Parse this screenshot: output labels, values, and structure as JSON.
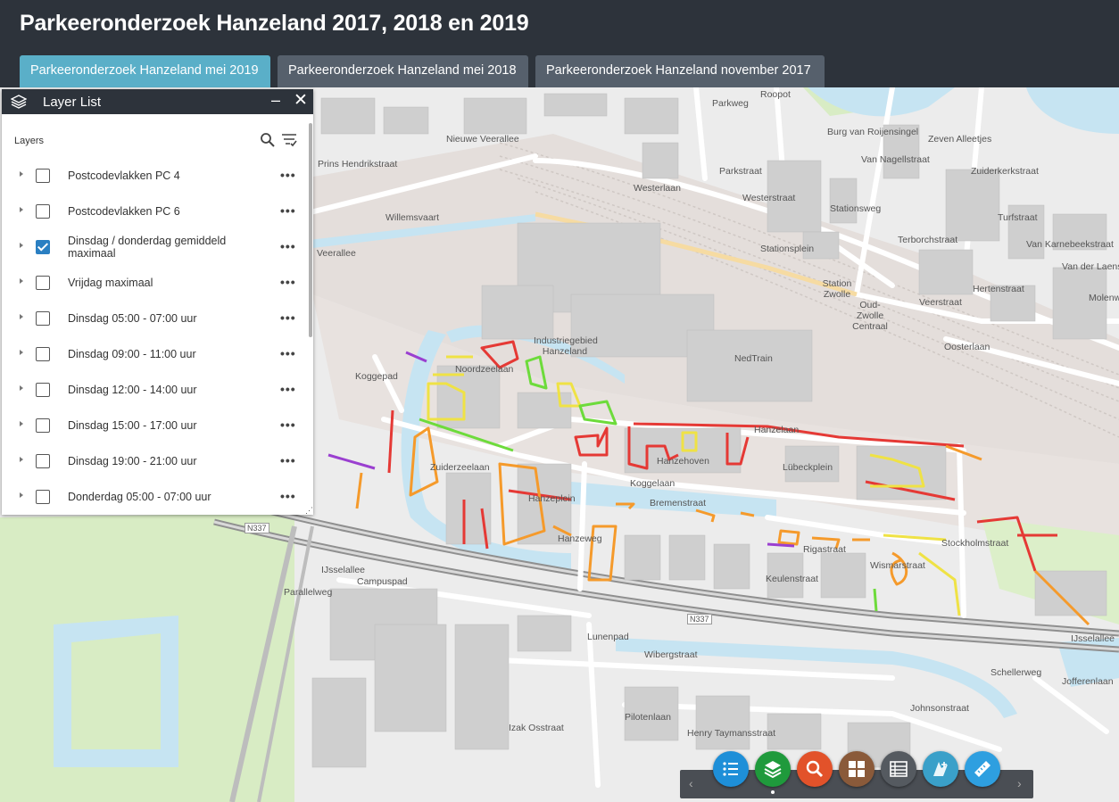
{
  "app": {
    "title": "Parkeeronderzoek Hanzeland 2017, 2018 en 2019"
  },
  "tabs": [
    {
      "label": "Parkeeronderzoek Hanzeland mei 2019",
      "active": true
    },
    {
      "label": "Parkeeronderzoek Hanzeland mei 2018",
      "active": false
    },
    {
      "label": "Parkeeronderzoek Hanzeland november 2017",
      "active": false
    }
  ],
  "panel": {
    "title": "Layer List",
    "icon": "layers-icon",
    "minimize_symbol": "–",
    "close_symbol": "✕",
    "layers_label": "Layers",
    "more_symbol": "•••",
    "layers": [
      {
        "label": "Postcodevlakken PC 4",
        "checked": false
      },
      {
        "label": "Postcodevlakken PC 6",
        "checked": false
      },
      {
        "label": "Dinsdag / donderdag gemiddeld maximaal",
        "checked": true
      },
      {
        "label": "Vrijdag maximaal",
        "checked": false
      },
      {
        "label": "Dinsdag 05:00 - 07:00 uur",
        "checked": false
      },
      {
        "label": "Dinsdag 09:00 - 11:00 uur",
        "checked": false
      },
      {
        "label": "Dinsdag 12:00 - 14:00 uur",
        "checked": false
      },
      {
        "label": "Dinsdag 15:00 - 17:00 uur",
        "checked": false
      },
      {
        "label": "Dinsdag 19:00 - 21:00 uur",
        "checked": false
      },
      {
        "label": "Donderdag 05:00 - 07:00 uur",
        "checked": false
      }
    ]
  },
  "map": {
    "labels": {
      "burg": "Burg van Roijensingel",
      "parkweg": "Parkweg",
      "westerlaan": "Westerlaan",
      "parkstraat": "Parkstraat",
      "westerstraat": "Westerstraat",
      "stationsplein": "Stationsplein",
      "stationsweg": "Stationsweg",
      "station": "Station Zwolle",
      "oudzwolle": "Oud-Zwolle Centraal",
      "zuiderkerk": "Zuiderkerkstraat",
      "turfstraat": "Turfstraat",
      "vankarnebeek": "Van Karnebeekstraat",
      "oosterlaan": "Oosterlaan",
      "nieuwe": "Nieuwe Veerallee",
      "willemsvaart": "Willemsvaart",
      "princehendrik": "Prins Hendrikstraat",
      "veerallee": "Veerallee",
      "industrie": "Industriegebied Hanzeland",
      "nedtrain": "NedTrain",
      "noordzee": "Noordzeelaan",
      "zuiderzee": "Zuiderzeelaan",
      "koggepad": "Koggepad",
      "koggelaan": "Koggelaan",
      "hanzehoven": "Hanzehoven",
      "hanzelaan": "Hanzelaan",
      "bremenstraat": "Bremenstraat",
      "rigastraat": "Rigastraat",
      "lubeck": "Lübeckplein",
      "stockholm": "Stockholmstraat",
      "ijsselallee1": "IJsselallee",
      "ijsselallee2": "IJsselallee",
      "n337a": "N337",
      "n337b": "N337",
      "campuspad": "Campuspad",
      "parallelweg": "Parallelweg",
      "wibergstraat": "Wibergstraat",
      "lunenpad": "Lunenpad",
      "schellerweg": "Schellerweg",
      "joffer": "Jofferenlaan",
      "johnson": "Johnsonstraat",
      "henry": "Henry Taymansstraat",
      "izak": "Izak Osstraat",
      "pilotenlaan": "Pilotenlaan",
      "hanzeplein": "Hanzeplein",
      "hanzeweg": "Hanzeweg",
      "wismarstraat": "Wismarstraat",
      "keulenstraat": "Keulenstraat",
      "terborch": "Terborchstraat",
      "vannagel": "Van Nagellstraat",
      "zevenalleetjes": "Zeven Alleetjes",
      "roopol": "Roopot",
      "molenweg": "Molenweg",
      "vandelaer": "Van der Laenstraat",
      "veerstraat": "Veerstraat",
      "hertenstraat": "Hertenstraat"
    },
    "colors": {
      "red": "#e53935",
      "orange": "#f59a2b",
      "yellow": "#efe245",
      "green": "#6ddb3b",
      "purple": "#9a3fd0",
      "water": "#c6e4f2",
      "park": "#d8ecc4"
    }
  },
  "dock": {
    "prev_symbol": "‹",
    "next_symbol": "›",
    "buttons": [
      {
        "name": "legend-icon",
        "color": "#1e8fd8"
      },
      {
        "name": "layer-list-icon",
        "color": "#1f9a3c"
      },
      {
        "name": "search-icon",
        "color": "#e2522a"
      },
      {
        "name": "basemap-gallery-icon",
        "color": "#8a5a3a"
      },
      {
        "name": "attribute-table-icon",
        "color": "#555a60"
      },
      {
        "name": "query-icon",
        "color": "#3aa0c9"
      },
      {
        "name": "measurement-icon",
        "color": "#2e9fe0"
      }
    ]
  }
}
